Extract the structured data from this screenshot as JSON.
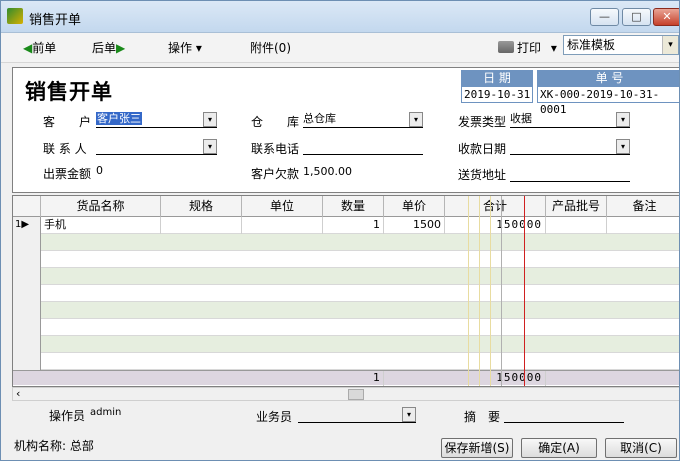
{
  "window": {
    "title": "销售开单",
    "min_glyph": "—",
    "max_glyph": "□",
    "close_glyph": "✕"
  },
  "toolbar": {
    "prev_label": "前单",
    "next_label": "后单",
    "ops_label": "操作",
    "attach_label": "附件(0)",
    "print_label": "打印",
    "template_value": "标准模板",
    "prev_icon": "◀",
    "next_icon": "▶",
    "dropdown_icon": "▾"
  },
  "form": {
    "title": "销售开单",
    "date": {
      "label": "日 期",
      "value": "2019-10-31"
    },
    "number": {
      "label": "单 号",
      "value": "XK-000-2019-10-31-0001"
    },
    "customer": {
      "label": "客　　户",
      "value": "客户张三"
    },
    "warehouse": {
      "label": "仓　　库",
      "value": "总仓库"
    },
    "invoice_type": {
      "label": "发票类型",
      "value": "收据"
    },
    "contact": {
      "label": "联 系 人",
      "value": ""
    },
    "phone": {
      "label": "联系电话",
      "value": ""
    },
    "payment_date": {
      "label": "收款日期",
      "value": ""
    },
    "invoice_amount": {
      "label": "出票金额",
      "value": "0"
    },
    "customer_debt": {
      "label": "客户欠款",
      "value": "1,500.00"
    },
    "address": {
      "label": "送货地址",
      "value": ""
    }
  },
  "grid": {
    "columns": [
      "货品名称",
      "规格",
      "单位",
      "数量",
      "单价",
      "合计",
      "产品批号",
      "备注"
    ],
    "rows": [
      {
        "num": "1",
        "marker": "▶",
        "name": "手机",
        "spec": "",
        "unit": "",
        "qty": "1",
        "price": "1500",
        "total": "150000",
        "batch": "",
        "note": ""
      }
    ],
    "total_qty": "1",
    "total_amount": "150000"
  },
  "footer": {
    "operator_label": "操作员",
    "operator_value": "admin",
    "salesperson_label": "业务员",
    "summary_label": "摘　要",
    "org": "机构名称: 总部",
    "save_new": "保存新增(S)",
    "confirm": "确定(A)",
    "cancel": "取消(C)"
  },
  "colors": {
    "accent": "#6e93c0",
    "row_alt": "#e6eedf",
    "red_line": "#d02020"
  }
}
